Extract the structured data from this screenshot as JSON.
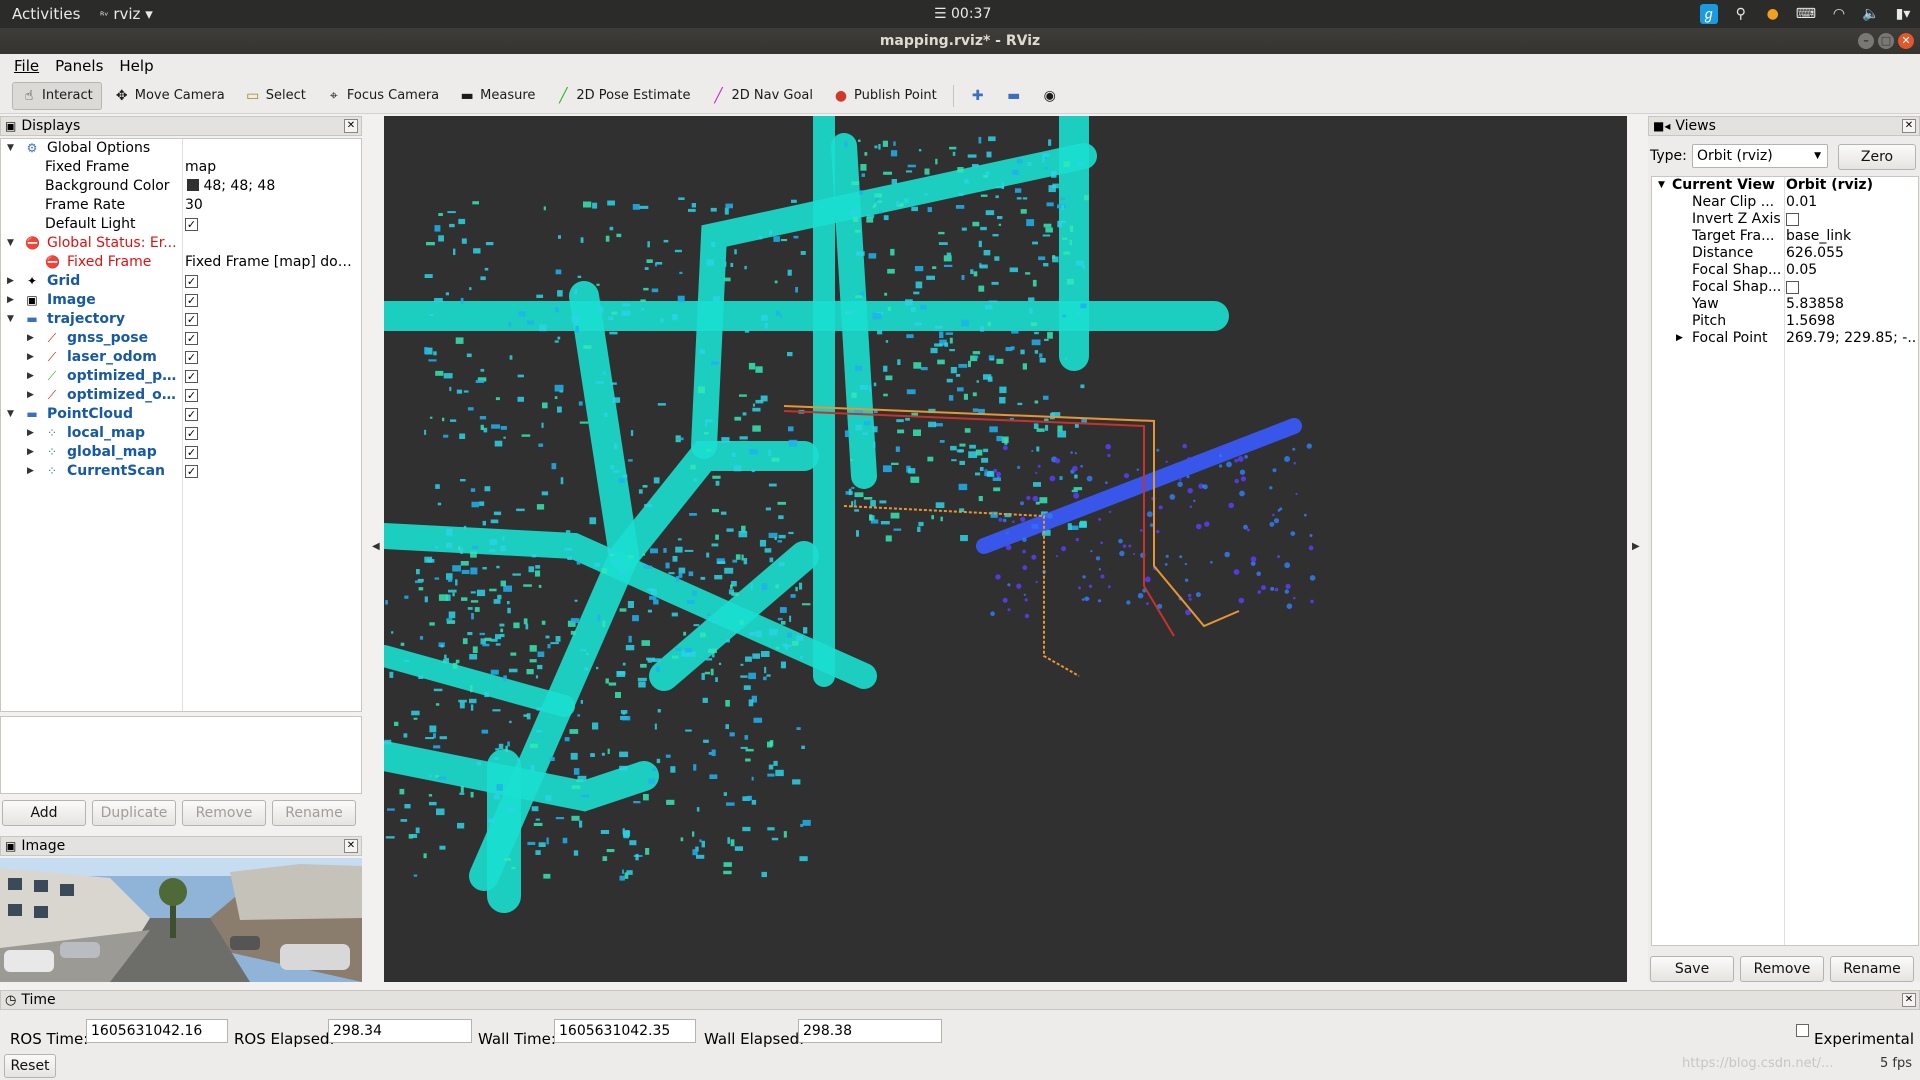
{
  "topbar": {
    "activities": "Activities",
    "app_name": "rviz",
    "clock": "00:37"
  },
  "window": {
    "title": "mapping.rviz* - RViz"
  },
  "menu": [
    "File",
    "Panels",
    "Help"
  ],
  "toolbar": {
    "tools": [
      {
        "label": "Interact",
        "icon": "hand-icon",
        "active": true
      },
      {
        "label": "Move Camera",
        "icon": "move-camera-icon"
      },
      {
        "label": "Select",
        "icon": "select-icon"
      },
      {
        "label": "Focus Camera",
        "icon": "focus-camera-icon"
      },
      {
        "label": "Measure",
        "icon": "ruler-icon"
      },
      {
        "label": "2D Pose Estimate",
        "icon": "pose-estimate-arrow-icon"
      },
      {
        "label": "2D Nav Goal",
        "icon": "nav-goal-arrow-icon"
      },
      {
        "label": "Publish Point",
        "icon": "map-pin-icon"
      }
    ]
  },
  "displays": {
    "title": "Displays",
    "rows": [
      {
        "name": "Global Options",
        "value": ""
      },
      {
        "name": "Fixed Frame",
        "value": "map"
      },
      {
        "name": "Background Color",
        "value": "48; 48; 48"
      },
      {
        "name": "Frame Rate",
        "value": "30"
      },
      {
        "name": "Default Light",
        "value": ""
      },
      {
        "name": "Global Status: Er...",
        "value": ""
      },
      {
        "name": "Fixed Frame",
        "value": "Fixed Frame [map] doe..."
      },
      {
        "name": "Grid",
        "value": ""
      },
      {
        "name": "Image",
        "value": ""
      },
      {
        "name": "trajectory",
        "value": ""
      },
      {
        "name": "gnss_pose",
        "value": ""
      },
      {
        "name": "laser_odom",
        "value": ""
      },
      {
        "name": "optimized_p...",
        "value": ""
      },
      {
        "name": "optimized_o...",
        "value": ""
      },
      {
        "name": "PointCloud",
        "value": ""
      },
      {
        "name": "local_map",
        "value": ""
      },
      {
        "name": "global_map",
        "value": ""
      },
      {
        "name": "CurrentScan",
        "value": ""
      }
    ],
    "buttons": {
      "add": "Add",
      "duplicate": "Duplicate",
      "remove": "Remove",
      "rename": "Rename"
    }
  },
  "image_panel": {
    "title": "Image"
  },
  "views": {
    "title": "Views",
    "type_label": "Type:",
    "type_value": "Orbit (rviz)",
    "zero": "Zero",
    "current_view": "Current View",
    "current_view_type": "Orbit (rviz)",
    "props": [
      {
        "k": "Near Clip ...",
        "v": "0.01"
      },
      {
        "k": "Invert Z Axis",
        "v": ""
      },
      {
        "k": "Target Fra...",
        "v": "base_link"
      },
      {
        "k": "Distance",
        "v": "626.055"
      },
      {
        "k": "Focal Shap...",
        "v": "0.05"
      },
      {
        "k": "Focal Shap...",
        "v": ""
      },
      {
        "k": "Yaw",
        "v": "5.83858"
      },
      {
        "k": "Pitch",
        "v": "1.5698"
      },
      {
        "k": "Focal Point",
        "v": "269.79; 229.85; -..."
      }
    ],
    "buttons": {
      "save": "Save",
      "remove": "Remove",
      "rename": "Rename"
    }
  },
  "time": {
    "title": "Time",
    "ros_time_label": "ROS Time:",
    "ros_time": "1605631042.16",
    "ros_elapsed_label": "ROS Elapsed:",
    "ros_elapsed": "298.34",
    "wall_time_label": "Wall Time:",
    "wall_time": "1605631042.35",
    "wall_elapsed_label": "Wall Elapsed:",
    "wall_elapsed": "298.38",
    "experimental": "Experimental",
    "reset": "Reset",
    "fps": "5 fps",
    "watermark": "https://blog.csdn.net/..."
  }
}
